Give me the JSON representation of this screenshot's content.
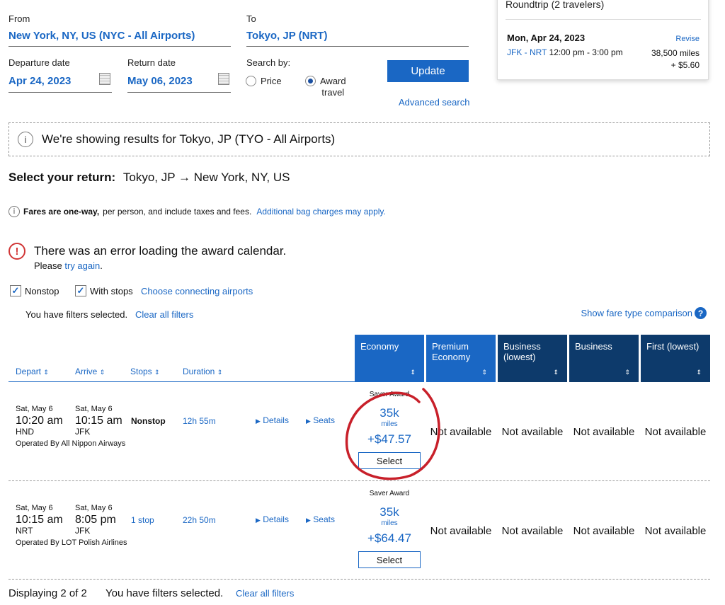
{
  "search": {
    "from_label": "From",
    "from_value": "New York, NY, US (NYC - All Airports)",
    "to_label": "To",
    "to_value": "Tokyo, JP (NRT)",
    "departure_label": "Departure date",
    "departure_value": "Apr 24, 2023",
    "return_label": "Return date",
    "return_value": "May 06, 2023",
    "search_by_label": "Search by:",
    "price_label": "Price",
    "award_label_1": "Award",
    "award_label_2": "travel",
    "update_label": "Update",
    "advanced_label": "Advanced search"
  },
  "trip_card": {
    "title": "Roundtrip (2 travelers)",
    "date": "Mon, Apr 24, 2023",
    "revise": "Revise",
    "route": "JFK - NRT",
    "time": "12:00 pm - 3:00 pm",
    "miles": "38,500 miles",
    "fee": "+ $5.60"
  },
  "notice": {
    "text": "We're showing results for Tokyo, JP (TYO - All Airports)"
  },
  "select_return": {
    "label": "Select your return:",
    "route": "Tokyo, JP → New York, NY, US"
  },
  "fares": {
    "bold": "Fares are one-way,",
    "text": "per person, and include taxes and fees.",
    "link": "Additional bag charges may apply."
  },
  "error": {
    "title": "There was an error loading the award calendar.",
    "pre": "Please",
    "link": "try again",
    "post": "."
  },
  "filters": {
    "nonstop": "Nonstop",
    "with_stops": "With stops",
    "connecting": "Choose connecting airports",
    "selected_text": "You have filters selected.",
    "clear": "Clear all filters",
    "compare": "Show fare type comparison"
  },
  "columns": {
    "depart": "Depart",
    "arrive": "Arrive",
    "stops": "Stops",
    "duration": "Duration",
    "fare_types": [
      {
        "label": "Economy",
        "color": "#1a67c4"
      },
      {
        "label": "Premium Economy",
        "color": "#1a67c4"
      },
      {
        "label": "Business (lowest)",
        "color": "#0d3a6b"
      },
      {
        "label": "Business",
        "color": "#0d3a6b"
      },
      {
        "label": "First (lowest)",
        "color": "#0d3a6b"
      }
    ]
  },
  "flights": [
    {
      "dep_date": "Sat, May 6",
      "arr_date": "Sat, May 6",
      "dep_time": "10:20 am",
      "arr_time": "10:15 am",
      "dep_airport": "HND",
      "arr_airport": "JFK",
      "stops": "Nonstop",
      "duration": "12h 55m",
      "operator": "Operated By All Nippon Airways",
      "details": "Details",
      "seats": "Seats",
      "award_type": "Saver Award",
      "miles": "35k",
      "miles_unit": "miles",
      "price": "+$47.57",
      "select": "Select",
      "na": [
        "Not available",
        "Not available",
        "Not available",
        "Not available"
      ]
    },
    {
      "dep_date": "Sat, May 6",
      "arr_date": "Sat, May 6",
      "dep_time": "10:15 am",
      "arr_time": "8:05 pm",
      "dep_airport": "NRT",
      "arr_airport": "JFK",
      "stops": "1 stop",
      "duration": "22h 50m",
      "operator": "Operated By LOT Polish Airlines",
      "details": "Details",
      "seats": "Seats",
      "award_type": "Saver Award",
      "miles": "35k",
      "miles_unit": "miles",
      "price": "+$64.47",
      "select": "Select",
      "na": [
        "Not available",
        "Not available",
        "Not available",
        "Not available"
      ]
    }
  ],
  "footer": {
    "displaying": "Displaying 2 of 2",
    "selected_text": "You have filters selected.",
    "clear": "Clear all filters"
  },
  "colors": {
    "accent": "#1a67c4",
    "dark_header": "#0d3a6b",
    "error": "#d13636",
    "annotation": "#c8202a"
  }
}
